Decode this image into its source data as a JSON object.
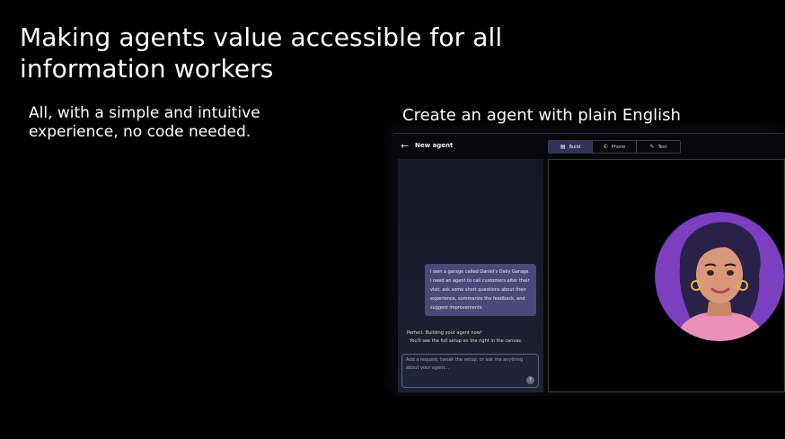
{
  "slide": {
    "headline": "Making agents value accessible for all information workers",
    "subline": "All, with a simple and intuitive experience, no code needed.",
    "caption": "Create an agent with plain English"
  },
  "app": {
    "title": "New agent",
    "back_icon": "arrow-left-icon",
    "tabs": [
      {
        "label": "Build",
        "icon": "build-icon",
        "active": true
      },
      {
        "label": "Phone",
        "icon": "phone-icon",
        "active": false
      },
      {
        "label": "Test",
        "icon": "test-icon",
        "active": false
      }
    ],
    "chat": {
      "user_message": "I own a garage called Daniel's Daily Garage. I need an agent to call customers after their visit, ask some short questions about their experience, summarize the feedback, and suggest improvements",
      "agent_reply_line1": "Perfect. Building your agent now!",
      "agent_reply_line2": "You'll see the full setup on the right in the canvas.",
      "input_placeholder": "Add a request, tweak the setup, or ask me anything about your agent..."
    },
    "canvas": {
      "avatar": "agent-avatar-woman"
    }
  },
  "colors": {
    "accent": "#4c4878",
    "tab_active": "#34305a",
    "canvas_border": "#26463e",
    "avatar_bg": "#7b3fbf"
  }
}
